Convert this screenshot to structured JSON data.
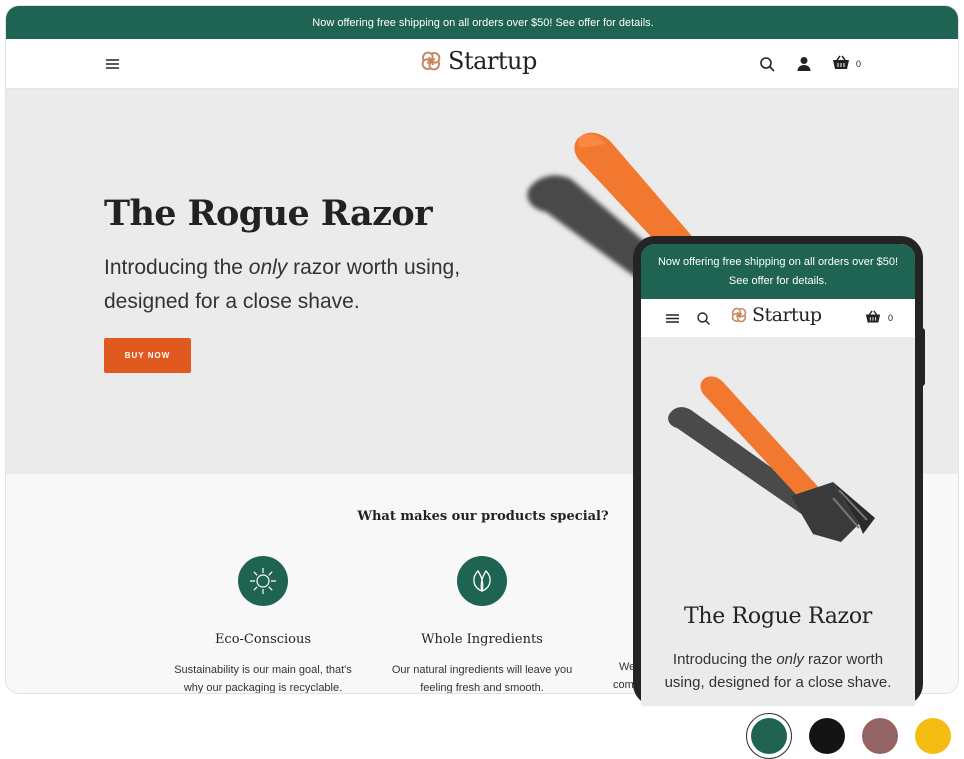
{
  "announcement": {
    "text": "Now offering free shipping on all orders over $50! See offer for details."
  },
  "header": {
    "brand": "Startup",
    "cart_count": "0"
  },
  "hero": {
    "title": "The Rogue Razor",
    "sub_before": "Introducing the ",
    "sub_em": "only",
    "sub_after": " razor worth using, designed for a close shave.",
    "button": "BUY NOW"
  },
  "features": {
    "heading": "What makes our products special?",
    "items": [
      {
        "title": "Eco-Conscious",
        "desc": "Sustainability is our main goal, that's why our packaging is recyclable.",
        "icon": "sun-icon"
      },
      {
        "title": "Whole Ingredients",
        "desc": "Our natural ingredients will leave you feeling fresh and smooth.",
        "icon": "leaf-icon"
      }
    ],
    "cut_line1": "We",
    "cut_line2": "com"
  },
  "phone": {
    "announcement": "Now offering free shipping on all orders over $50! See offer for details.",
    "brand": "Startup",
    "cart_count": "0",
    "title": "The Rogue Razor",
    "sub_before": "Introducing the ",
    "sub_em": "only",
    "sub_after": " razor worth using, designed for a close shave."
  },
  "colors": {
    "brand_green": "#1f6352",
    "accent_orange": "#e05a1f",
    "swatches": [
      "#1f6352",
      "#141414",
      "#946364",
      "#f5bd13"
    ]
  }
}
